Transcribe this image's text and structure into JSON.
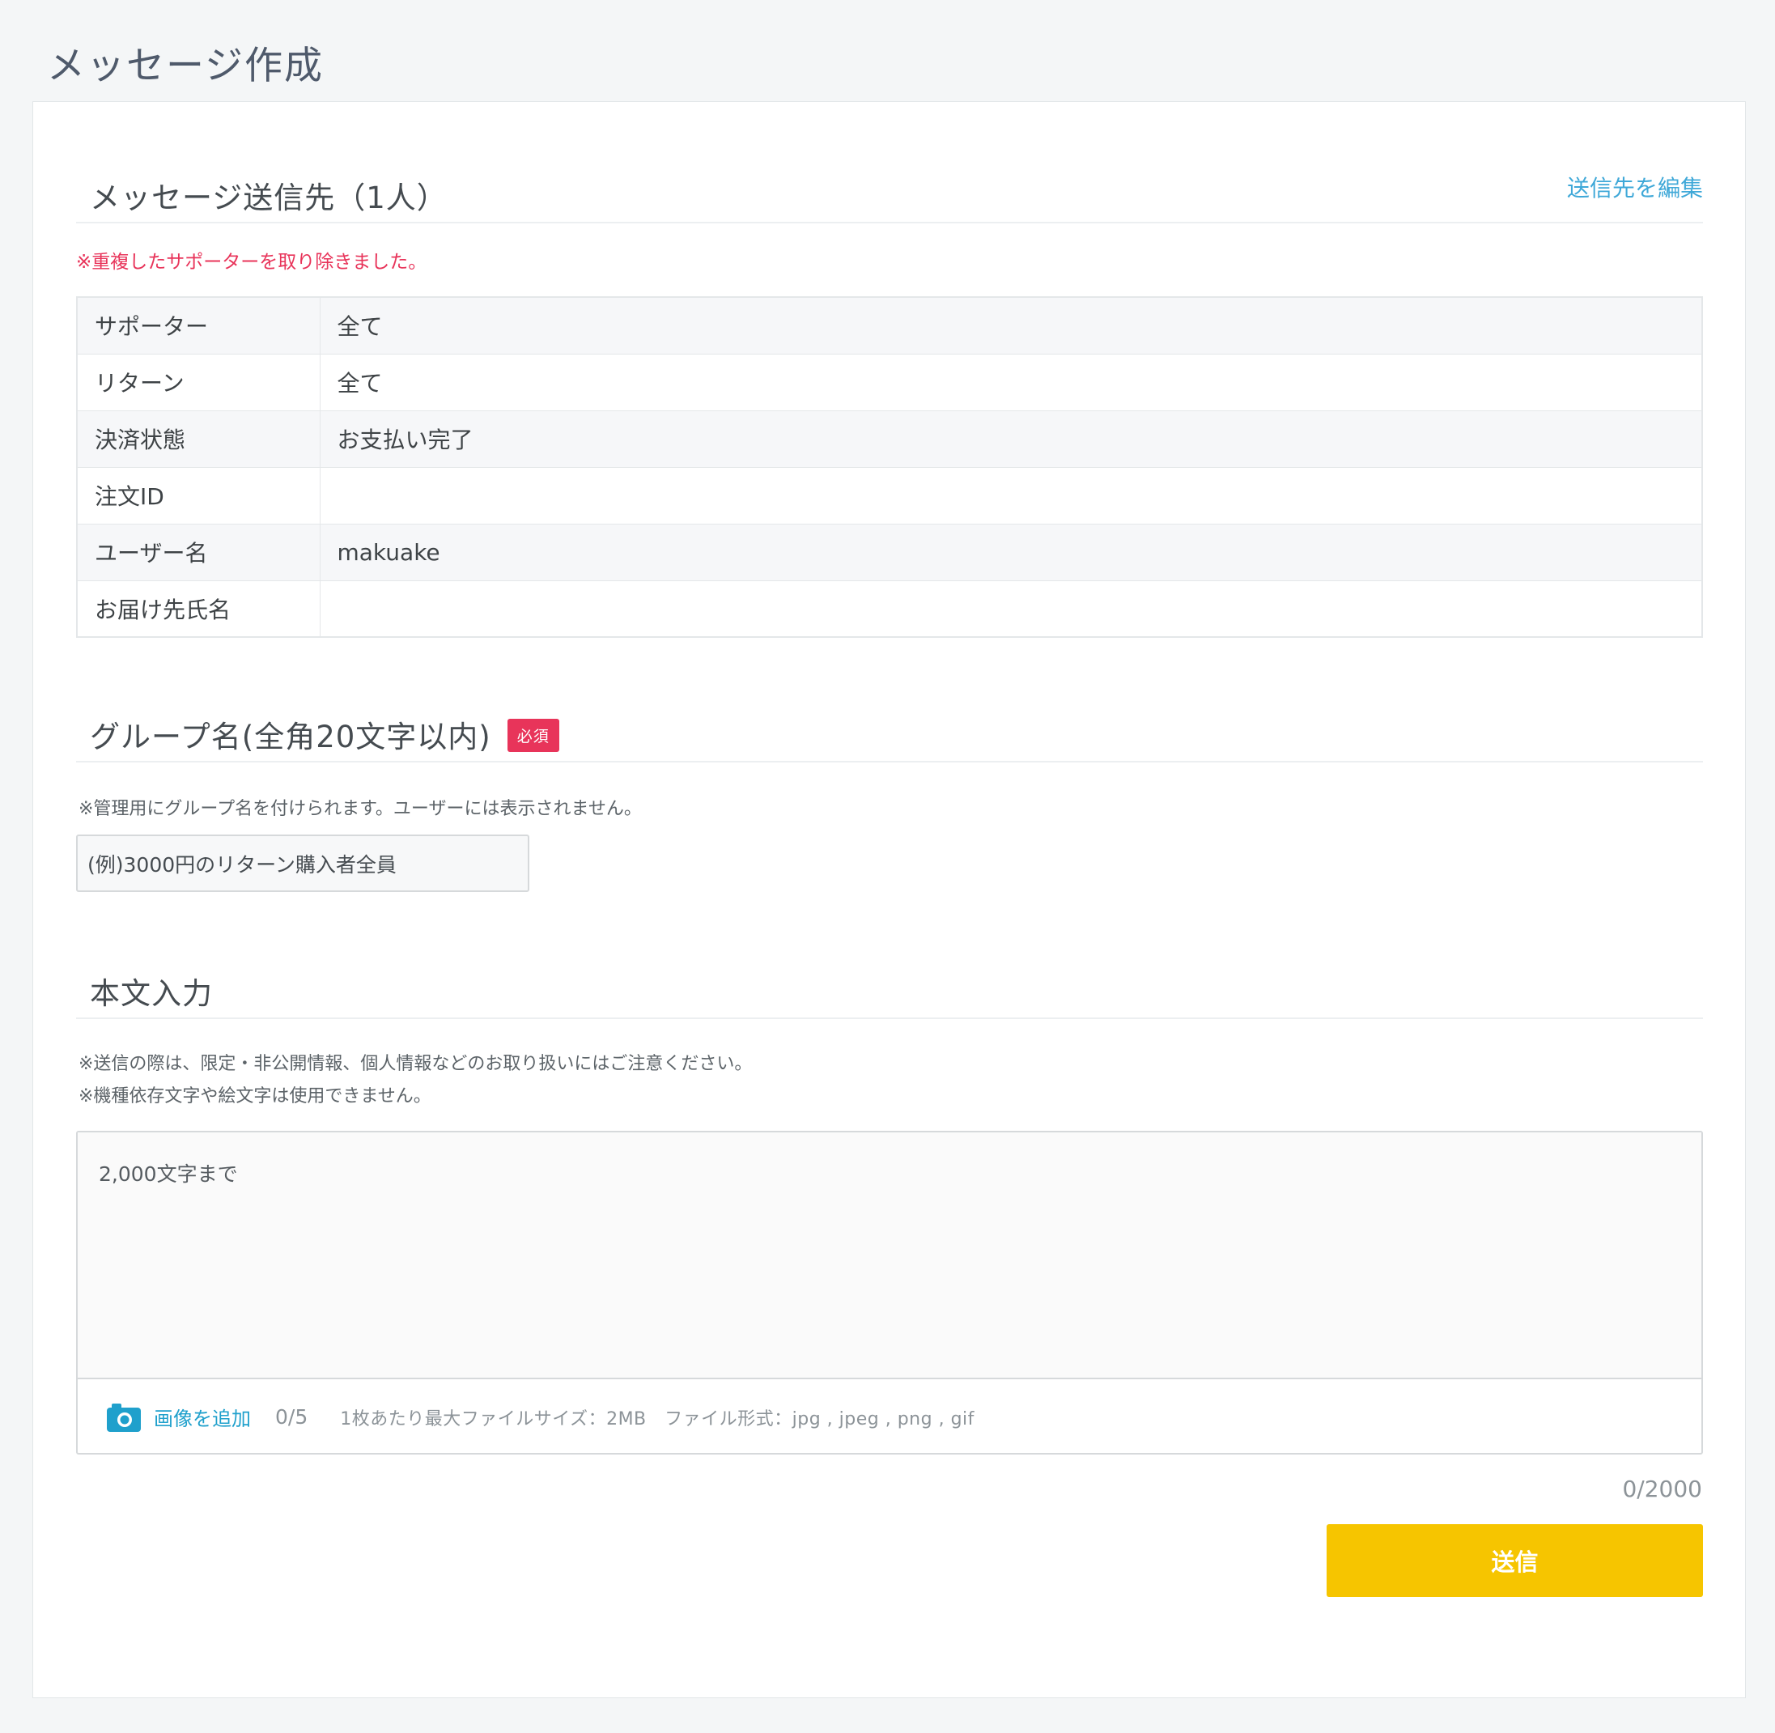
{
  "page": {
    "title": "メッセージ作成"
  },
  "recipients": {
    "title": "メッセージ送信先（1人）",
    "edit_link": "送信先を編集",
    "notice": "※重複したサポーターを取り除きました。",
    "rows": [
      {
        "label": "サポーター",
        "value": "全て"
      },
      {
        "label": "リターン",
        "value": "全て"
      },
      {
        "label": "決済状態",
        "value": "お支払い完了"
      },
      {
        "label": "注文ID",
        "value": ""
      },
      {
        "label": "ユーザー名",
        "value": "makuake"
      },
      {
        "label": "お届け先氏名",
        "value": ""
      }
    ]
  },
  "group": {
    "title": "グループ名(全角20文字以内)",
    "required_badge": "必須",
    "hint": "※管理用にグループ名を付けられます。ユーザーには表示されません。",
    "input_placeholder": "(例)3000円のリターン購入者全員"
  },
  "body": {
    "title": "本文入力",
    "hint1": "※送信の際は、限定・非公開情報、個人情報などのお取り扱いにはご注意ください。",
    "hint2": "※機種依存文字や絵文字は使用できません。",
    "textarea_placeholder": "2,000文字まで",
    "attach_icon": "camera-icon",
    "attach_label": "画像を追加",
    "attach_count": "0/5",
    "attach_info": "1枚あたり最大ファイルサイズ：2MB　ファイル形式：jpg , jpeg , png , gif",
    "char_counter": "0/2000"
  },
  "actions": {
    "send_label": "送信"
  },
  "colors": {
    "accent_link": "#3fa8d8",
    "required_red": "#e8345a",
    "send_yellow": "#f6c500",
    "background": "#f4f6f7"
  }
}
